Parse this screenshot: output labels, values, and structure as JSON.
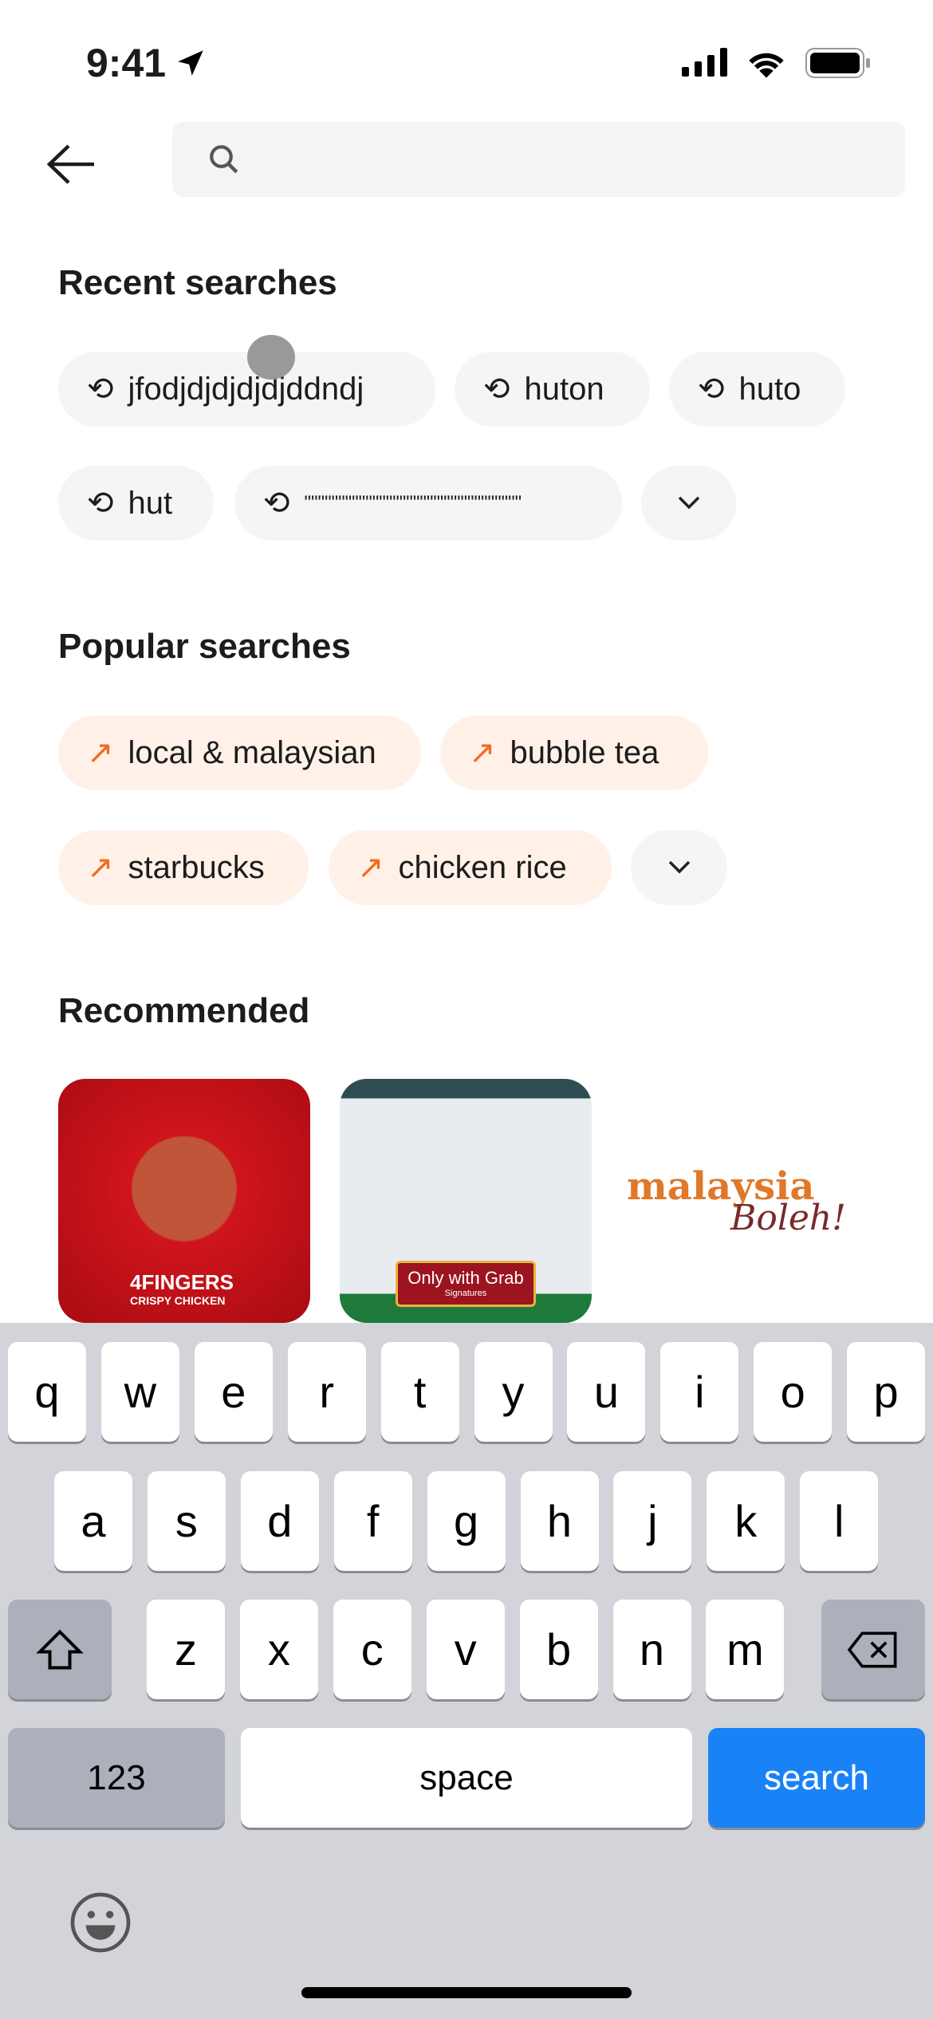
{
  "status_bar": {
    "time": "9:41"
  },
  "search": {
    "placeholder": ""
  },
  "recent": {
    "title": "Recent searches",
    "items": [
      "jfodjdjdjdjdjddndj",
      "huton",
      "huto",
      "hut",
      "\"\"\"\"\"\"\"\"\"\"\"\"\"\"\"\"\"\"\"\"\"\"\"\"\"\"\"\"\"\"\"\""
    ]
  },
  "popular": {
    "title": "Popular searches",
    "items": [
      "local & malaysian",
      "bubble tea",
      "starbucks",
      "chicken rice"
    ],
    "accent": "#f26b21"
  },
  "recommended": {
    "title": "Recommended",
    "items": [
      {
        "brand": "4FINGERS",
        "tagline": "CRISPY CHICKEN"
      },
      {
        "badge": "Only with Grab",
        "sub": "Signatures"
      },
      {
        "logo": "malaysia",
        "script": "Boleh!"
      }
    ]
  },
  "keyboard": {
    "row1": [
      "q",
      "w",
      "e",
      "r",
      "t",
      "y",
      "u",
      "i",
      "o",
      "p"
    ],
    "row2": [
      "a",
      "s",
      "d",
      "f",
      "g",
      "h",
      "j",
      "k",
      "l"
    ],
    "row3": [
      "z",
      "x",
      "c",
      "v",
      "b",
      "n",
      "m"
    ],
    "numbers": "123",
    "space": "space",
    "search": "search",
    "search_color": "#1a82f7"
  }
}
